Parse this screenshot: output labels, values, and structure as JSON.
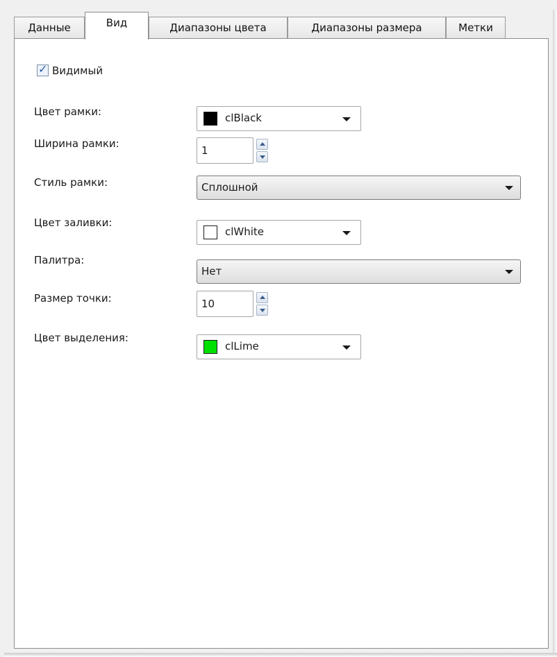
{
  "tabs": [
    {
      "label": "Данные"
    },
    {
      "label": "Вид"
    },
    {
      "label": "Диапазоны цвета"
    },
    {
      "label": "Диапазоны размера"
    },
    {
      "label": "Метки"
    }
  ],
  "active_tab": "Вид",
  "visible_checkbox": {
    "label": "Видимый",
    "checked": true
  },
  "fields": {
    "frame_color": {
      "label": "Цвет рамки:",
      "value": "clBlack",
      "swatch": "#000000"
    },
    "frame_width": {
      "label": "Ширина рамки:",
      "value": "1"
    },
    "frame_style": {
      "label": "Стиль рамки:",
      "value": "Сплошной"
    },
    "fill_color": {
      "label": "Цвет заливки:",
      "value": "clWhite",
      "swatch": "#ffffff"
    },
    "palette": {
      "label": "Палитра:",
      "value": "Нет"
    },
    "point_size": {
      "label": "Размер точки:",
      "value": "10"
    },
    "selection_color": {
      "label": "Цвет выделения:",
      "value": "clLime",
      "swatch": "#00e000"
    }
  },
  "icons": {
    "dropdown": "triangle-down",
    "spin_up": "triangle-up",
    "spin_down": "triangle-down",
    "check": "check-mark"
  }
}
